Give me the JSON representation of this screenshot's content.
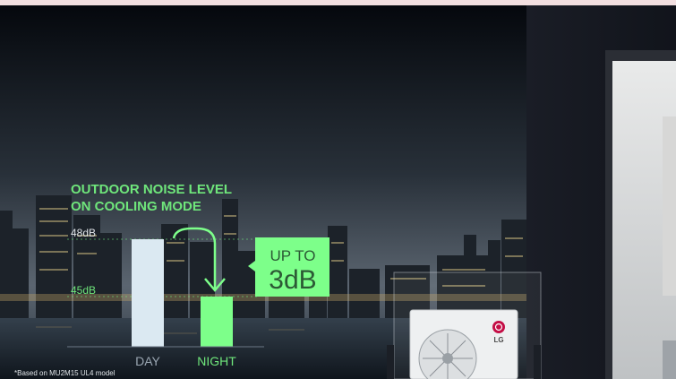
{
  "chart_data": {
    "type": "bar",
    "title_lines": [
      "OUTDOOR NOISE LEVEL",
      "ON COOLING MODE"
    ],
    "categories": [
      "DAY",
      "NIGHT"
    ],
    "values": [
      48,
      45
    ],
    "unit": "dB",
    "tick_labels": [
      "48dB",
      "45dB"
    ],
    "ticks": [
      48,
      45
    ],
    "callout": {
      "line1": "UP TO",
      "line2": "3dB"
    },
    "footnote": "*Based on MU2M15 UL4 model"
  },
  "colors": {
    "accent_green": "#7dff8a",
    "title_green": "#6fe67b",
    "day_bar": "#dbe9f2",
    "night_bar": "#7dff8a",
    "label_gray": "#9aa6b2",
    "callout_bg": "#7dff8a",
    "callout_text": "#2c5a35"
  },
  "product": {
    "brand_mark": "LG"
  },
  "icons": {
    "arrow": "curved-arrow-down-icon",
    "brand": "lg-logo-icon"
  }
}
